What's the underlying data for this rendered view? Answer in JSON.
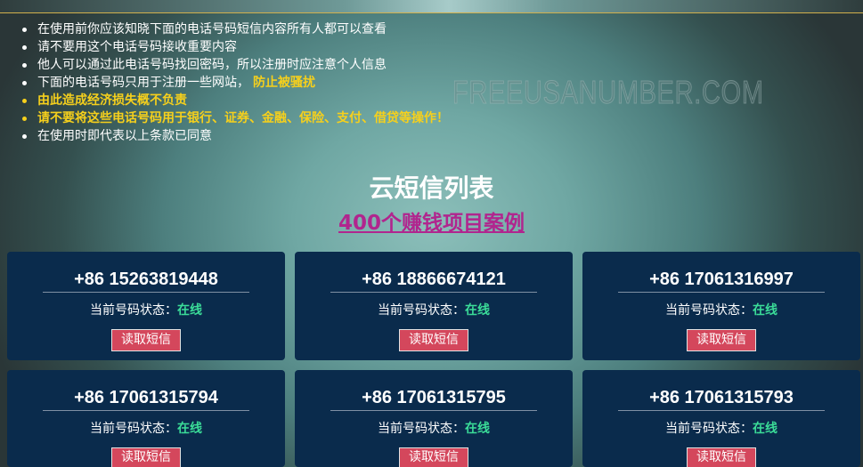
{
  "site_watermark": "FREEUSANUMBER.COM",
  "notices": [
    {
      "text": "在使用前你应该知晓下面的电话号码短信内容所有人都可以查看"
    },
    {
      "text": "请不要用这个电话号码接收重要内容"
    },
    {
      "text": "他人可以通过此电话号码找回密码，所以注册时应注意个人信息"
    },
    {
      "text": "下面的电话号码只用于注册一些网站，",
      "highlight": "防止被骚扰"
    },
    {
      "highlight": "由此造成经济损失概不负责"
    },
    {
      "highlight": "请不要将这些电话号码用于银行、证券、金融、保险、支付、借贷等操作！"
    },
    {
      "text": "在使用时即代表以上条款已同意"
    }
  ],
  "sms_list": {
    "title": "云短信列表",
    "promo_link": "400个赚钱项目案例",
    "cards": [
      {
        "number": "+86 15263819448",
        "status_label": "当前号码状态：",
        "status": "在线",
        "button": "读取短信"
      },
      {
        "number": "+86 18866674121",
        "status_label": "当前号码状态：",
        "status": "在线",
        "button": "读取短信"
      },
      {
        "number": "+86 17061316997",
        "status_label": "当前号码状态：",
        "status": "在线",
        "button": "读取短信"
      },
      {
        "number": "+86 17061315794",
        "status_label": "当前号码状态：",
        "status": "在线",
        "button": "读取短信"
      },
      {
        "number": "+86 17061315795",
        "status_label": "当前号码状态：",
        "status": "在线",
        "button": "读取短信"
      },
      {
        "number": "+86 17061315793",
        "status_label": "当前号码状态：",
        "status": "在线",
        "button": "读取短信"
      }
    ]
  },
  "colors": {
    "highlight": "#f6d01c",
    "online": "#3bdc98",
    "button": "#d4475c",
    "link": "#b1258e",
    "card": "#0a2b4c"
  }
}
